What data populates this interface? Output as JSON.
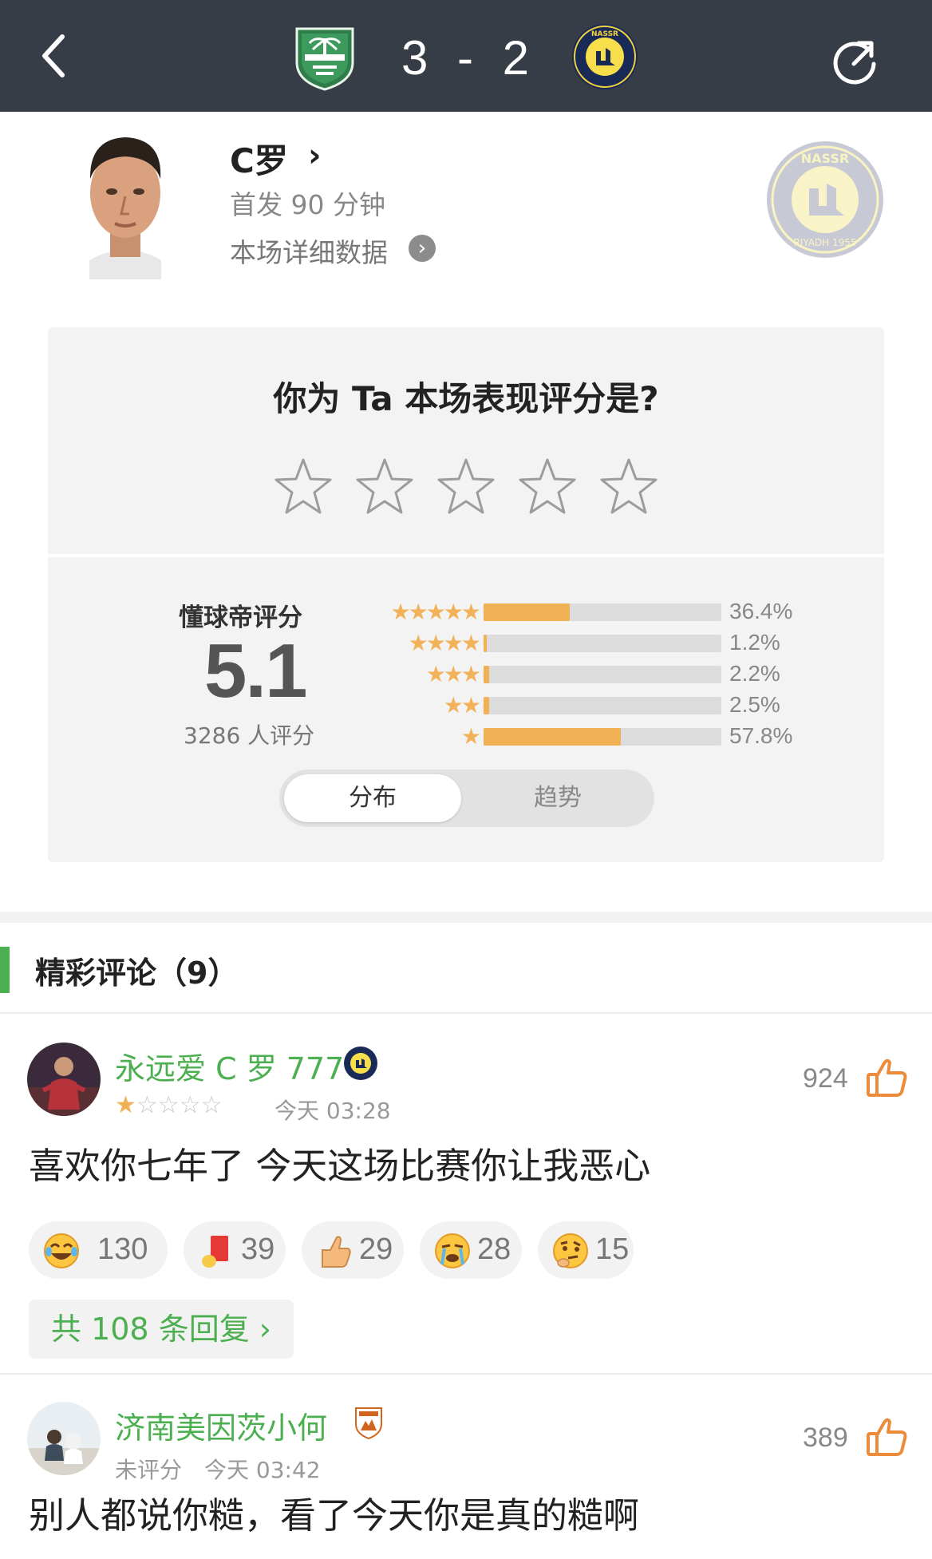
{
  "header": {
    "score": "3 - 2",
    "home_team_icon": "al-ahli-crest-icon",
    "away_team_icon": "al-nassr-crest-icon",
    "back_icon": "chevron-left-icon",
    "refresh_icon": "refresh-icon"
  },
  "player": {
    "name": "C罗",
    "start_info": "首发 90 分钟",
    "detail_link": "本场详细数据",
    "team_watermark": "al-nassr-crest-icon"
  },
  "rate_prompt": {
    "question": "你为 Ta 本场表现评分是?",
    "star_count": 5
  },
  "rating": {
    "label": "懂球帝评分",
    "score": "5.1",
    "count": "3286 人评分",
    "distribution": [
      {
        "stars": 5,
        "percent": 36.4,
        "label": "36.4%"
      },
      {
        "stars": 4,
        "percent": 1.2,
        "label": "1.2%"
      },
      {
        "stars": 3,
        "percent": 2.2,
        "label": "2.2%"
      },
      {
        "stars": 2,
        "percent": 2.5,
        "label": "2.5%"
      },
      {
        "stars": 1,
        "percent": 57.8,
        "label": "57.8%"
      }
    ],
    "tabs": {
      "active": "分布",
      "inactive": "趋势"
    }
  },
  "comments_section": {
    "title": "精彩评论（9）",
    "accent_color": "#4caf50"
  },
  "comments": [
    {
      "username": "永远爱 C 罗 777",
      "badge": "al-nassr-crest-icon",
      "stars": 1,
      "rating_text": "",
      "time": "今天 03:28",
      "likes": "924",
      "text": "喜欢你七年了 今天这场比赛你让我恶心",
      "reactions": [
        {
          "icon": "laughing-crying-emoji-icon",
          "count": "130"
        },
        {
          "icon": "red-card-icon",
          "count": "39"
        },
        {
          "icon": "thumbs-up-emoji-icon",
          "count": "29"
        },
        {
          "icon": "crying-emoji-icon",
          "count": "28"
        },
        {
          "icon": "thinking-emoji-icon",
          "count": "15"
        }
      ],
      "replies": "共 108 条回复 ›"
    },
    {
      "username": "济南美因茨小何",
      "badge": "shandong-taishan-crest-icon",
      "stars": 0,
      "rating_text": "未评分",
      "time": "今天 03:42",
      "likes": "389",
      "text": "别人都说你糙，看了今天你是真的糙啊"
    }
  ]
}
